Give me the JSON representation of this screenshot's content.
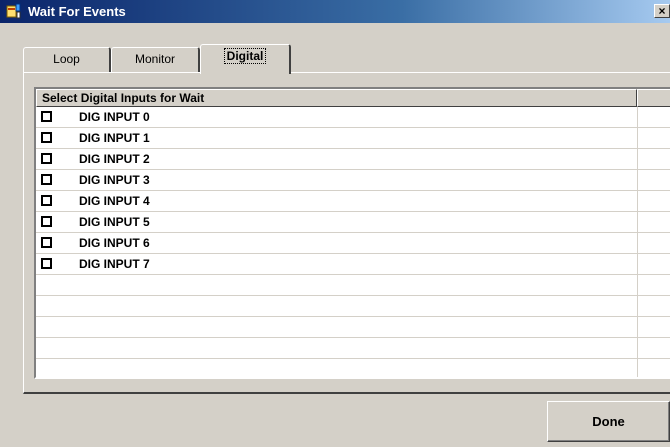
{
  "window": {
    "title": "Wait For Events",
    "close_label": "×"
  },
  "tabs": [
    {
      "label": "Loop"
    },
    {
      "label": "Monitor"
    },
    {
      "label": "Digital",
      "active": true
    }
  ],
  "list": {
    "header": "Select Digital Inputs for Wait",
    "items": [
      {
        "label": "DIG INPUT 0",
        "checked": false
      },
      {
        "label": "DIG INPUT 1",
        "checked": false
      },
      {
        "label": "DIG INPUT 2",
        "checked": false
      },
      {
        "label": "DIG INPUT 3",
        "checked": false
      },
      {
        "label": "DIG INPUT 4",
        "checked": false
      },
      {
        "label": "DIG INPUT 5",
        "checked": false
      },
      {
        "label": "DIG INPUT 6",
        "checked": false
      },
      {
        "label": "DIG INPUT 7",
        "checked": false
      }
    ]
  },
  "buttons": {
    "done_label": "Done"
  },
  "icons": {
    "app": "app-window-icon",
    "close": "close-icon",
    "checkbox": "checkbox-icon"
  }
}
